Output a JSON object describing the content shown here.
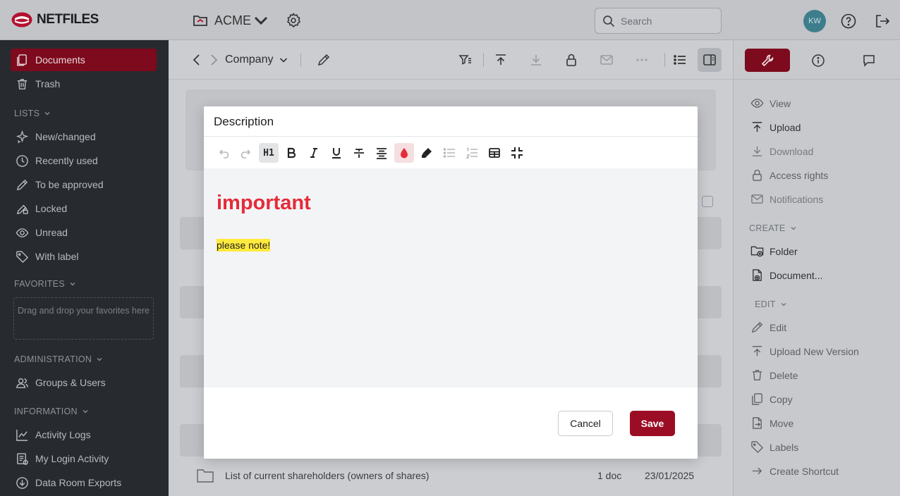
{
  "app": {
    "logo_text": "NETFILES"
  },
  "header": {
    "workspace": "ACME",
    "search_placeholder": "Search",
    "avatar_initials": "KW"
  },
  "sidebar": {
    "top_items": [
      {
        "label": "Documents",
        "icon": "document-icon",
        "active": true
      },
      {
        "label": "Trash",
        "icon": "trash-icon"
      }
    ],
    "lists_title": "LISTS",
    "list_items": [
      {
        "label": "New/changed",
        "icon": "sparkle-icon"
      },
      {
        "label": "Recently used",
        "icon": "clock-icon"
      },
      {
        "label": "To be approved",
        "icon": "pencil-icon"
      },
      {
        "label": "Locked",
        "icon": "lock-edit-icon"
      },
      {
        "label": "Unread",
        "icon": "eye-icon"
      },
      {
        "label": "With label",
        "icon": "tag-icon"
      }
    ],
    "favorites_title": "FAVORITES",
    "favorites_placeholder": "Drag and drop your favorites here",
    "administration_title": "ADMINISTRATION",
    "admin_items": [
      {
        "label": "Groups & Users",
        "icon": "users-icon"
      }
    ],
    "information_title": "INFORMATION",
    "info_items": [
      {
        "label": "Activity Logs",
        "icon": "chart-icon"
      },
      {
        "label": "My Login Activity",
        "icon": "list-icon"
      },
      {
        "label": "Data Room Exports",
        "icon": "download-circle-icon"
      }
    ]
  },
  "main": {
    "breadcrumb": "Company",
    "rows": [
      {
        "name": "List of current shareholders (owners of shares)",
        "count": "1 doc",
        "date": "23/01/2025"
      }
    ]
  },
  "dialog": {
    "title": "Description",
    "heading_text": "important",
    "paragraph_text": "please note!",
    "h1_label": "H1",
    "cancel_label": "Cancel",
    "save_label": "Save"
  },
  "right_panel": {
    "actions": [
      {
        "label": "View",
        "icon": "eye-icon",
        "style": "normal"
      },
      {
        "label": "Upload",
        "icon": "upload-icon",
        "style": "strong"
      },
      {
        "label": "Download",
        "icon": "download-icon",
        "style": "dim"
      },
      {
        "label": "Access rights",
        "icon": "lock-icon",
        "style": "normal"
      },
      {
        "label": "Notifications",
        "icon": "mail-icon",
        "style": "dim"
      }
    ],
    "create_title": "CREATE",
    "create_items": [
      {
        "label": "Folder",
        "icon": "folder-plus-icon"
      },
      {
        "label": "Document...",
        "icon": "document-plus-icon"
      }
    ],
    "edit_title": "EDIT",
    "edit_items": [
      {
        "label": "Edit",
        "icon": "pencil-icon"
      },
      {
        "label": "Upload New Version",
        "icon": "upload-icon"
      },
      {
        "label": "Delete",
        "icon": "trash-icon"
      },
      {
        "label": "Copy",
        "icon": "copy-icon"
      },
      {
        "label": "Move",
        "icon": "move-icon"
      },
      {
        "label": "Labels",
        "icon": "tag-icon"
      },
      {
        "label": "Create Shortcut",
        "icon": "arrow-right-icon"
      }
    ]
  },
  "colors": {
    "brand": "#9b0c25",
    "sidebar_bg": "#272b30",
    "heading_red": "#e52b3a",
    "highlight": "#ffea3d"
  }
}
